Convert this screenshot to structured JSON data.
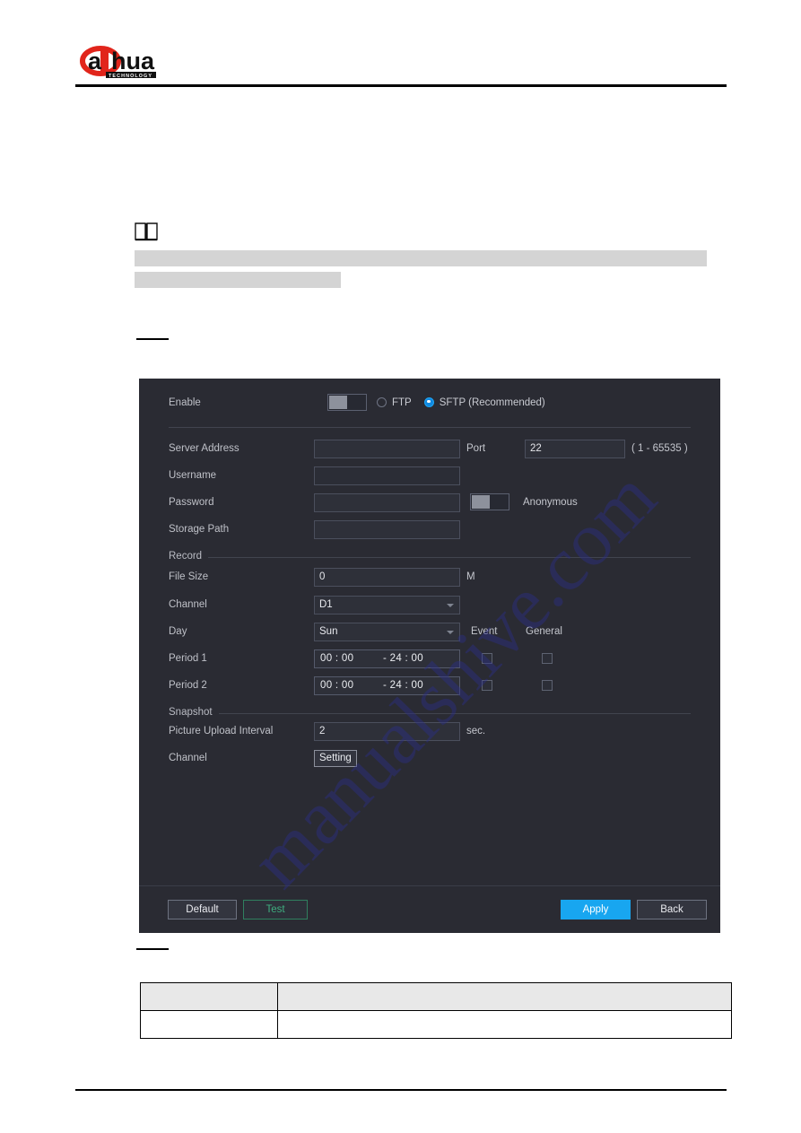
{
  "header": {
    "brand": "alhua",
    "brand_sub": "TECHNOLOGY",
    "logo_icon": "dahua-logo"
  },
  "note": {
    "icon": "book-note-icon",
    "redacted_lines": [
      "",
      ""
    ]
  },
  "dialog": {
    "watermark": "manualshive.com",
    "enable": {
      "label": "Enable",
      "toggle_state": "off",
      "protocols": [
        {
          "label": "FTP",
          "selected": false
        },
        {
          "label": "SFTP (Recommended)",
          "selected": true
        }
      ]
    },
    "server": {
      "address_label": "Server Address",
      "address_value": "",
      "port_label": "Port",
      "port_value": "22",
      "port_hint": "( 1 - 65535 )",
      "username_label": "Username",
      "username_value": "",
      "password_label": "Password",
      "password_value": "",
      "anonymous_label": "Anonymous",
      "anonymous_state": "off",
      "storage_path_label": "Storage Path",
      "storage_path_value": ""
    },
    "record": {
      "section_title": "Record",
      "file_size_label": "File Size",
      "file_size_value": "0",
      "file_size_unit": "M",
      "channel_label": "Channel",
      "channel_value": "D1",
      "day_label": "Day",
      "day_value": "Sun",
      "col_event": "Event",
      "col_general": "General",
      "periods": [
        {
          "label": "Period 1",
          "start": "00 : 00",
          "end": "- 24 : 00",
          "event_checked": false,
          "general_checked": false
        },
        {
          "label": "Period 2",
          "start": "00 : 00",
          "end": "- 24 : 00",
          "event_checked": false,
          "general_checked": false
        }
      ]
    },
    "snapshot": {
      "section_title": "Snapshot",
      "interval_label": "Picture Upload Interval",
      "interval_value": "2",
      "interval_unit": "sec.",
      "channel_label": "Channel",
      "channel_button": "Setting"
    },
    "footer": {
      "default_label": "Default",
      "test_label": "Test",
      "apply_label": "Apply",
      "back_label": "Back"
    }
  },
  "doc_table": {
    "header_cells": [
      "",
      ""
    ],
    "body_cells": [
      "",
      ""
    ]
  },
  "colors": {
    "dialog_bg": "#2a2b33",
    "accent_blue": "#18a6f0",
    "test_green": "#3fae7f",
    "brand_red": "#e1251b",
    "watermark": "#2b2e8c"
  }
}
